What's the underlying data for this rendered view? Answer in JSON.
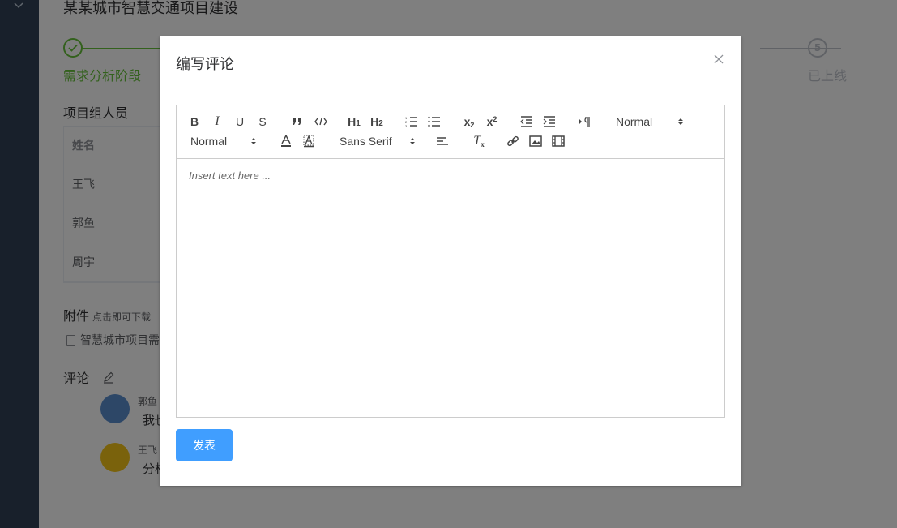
{
  "page": {
    "title": "某某城市智慧交通项目建设",
    "steps": {
      "first_number_icon": "check-icon",
      "first_label": "需求分析阶段",
      "last_number": "5",
      "last_label": "已上线"
    },
    "members": {
      "title": "项目组人员",
      "header": "姓名",
      "rows": [
        "王飞",
        "郭鱼",
        "周宇"
      ]
    },
    "attachments": {
      "title": "附件",
      "hint": "点击即可下载",
      "file": "智慧城市项目需"
    },
    "comments": {
      "title": "评论",
      "items": [
        {
          "author": "郭鱼",
          "text": "我也"
        },
        {
          "author": "王飞",
          "text": "分析"
        }
      ]
    }
  },
  "dialog": {
    "title": "编写评论",
    "toolbar": {
      "header_picker": "Normal",
      "size_picker": "Normal",
      "font_picker": "Sans Serif"
    },
    "editor_placeholder": "Insert text here ...",
    "submit_label": "发表"
  },
  "colors": {
    "sidebar": "#304156",
    "success": "#67c23a",
    "primary": "#409eff",
    "mask": "rgba(0,0,0,0.5)"
  }
}
